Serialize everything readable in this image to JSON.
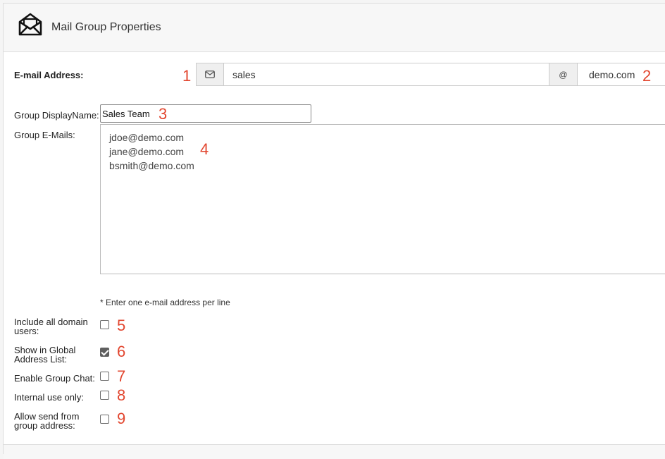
{
  "header": {
    "title": "Mail Group Properties",
    "icon": "envelope-open-icon"
  },
  "email_address": {
    "label": "E-mail Address:",
    "local_part": "sales",
    "at_symbol": "@",
    "domain": "demo.com",
    "icon": "envelope-icon"
  },
  "display_name": {
    "label": "Group DisplayName:",
    "value": "Sales Team"
  },
  "group_emails": {
    "label": "Group E-Mails:",
    "lines": [
      "jdoe@demo.com",
      "jane@demo.com",
      "bsmith@demo.com"
    ],
    "hint": "* Enter one e-mail address per line"
  },
  "options": [
    {
      "label_line1": "Include all domain",
      "label_line2": "users:",
      "checked": false
    },
    {
      "label_line1": "Show in Global",
      "label_line2": "Address List:",
      "checked": true
    },
    {
      "label_line1": "Enable Group Chat:",
      "label_line2": "",
      "checked": false
    },
    {
      "label_line1": "Internal use only:",
      "label_line2": "",
      "checked": false
    },
    {
      "label_line1": "Allow send from",
      "label_line2": "group address:",
      "checked": false
    }
  ],
  "annotations": [
    "1",
    "2",
    "3",
    "4",
    "5",
    "6",
    "7",
    "8",
    "9"
  ],
  "colors": {
    "annotation": "#e2462f",
    "header_bg": "#f7f7f7"
  }
}
